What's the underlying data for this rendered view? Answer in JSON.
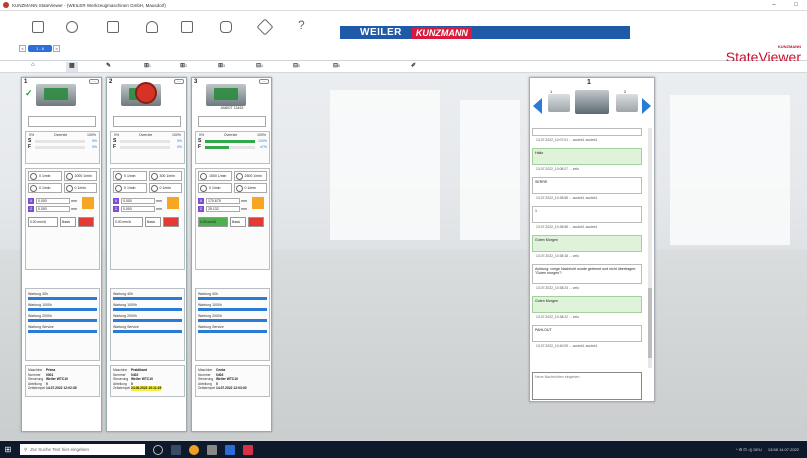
{
  "window": {
    "title": "KUNZMANN StateViewer - (WEILER Werkzeugmaschinen GmbH, Mausdorf)",
    "controls": [
      "–",
      "□"
    ]
  },
  "toolbar": {
    "nav_label": "1 - 6",
    "nav_prev": "<",
    "nav_next": ">"
  },
  "brand": {
    "weiler": "WEILER",
    "kunzmann": "KUNZMANN",
    "logo_small": "KUNZMANN",
    "logo_big": "StateViewer"
  },
  "colors": {
    "brand_blue": "#1f5aa8",
    "brand_red": "#d81b3c",
    "ok_green": "#2a9c3a",
    "alarm_red": "#d63327",
    "highlight": "#f4ee3c"
  },
  "tabs": [
    {
      "icon": "home-icon",
      "label": ""
    },
    {
      "icon": "grid-icon",
      "label": ""
    },
    {
      "icon": "wrench-icon",
      "label": ""
    },
    {
      "icon": "machine-icon",
      "label": "1"
    },
    {
      "icon": "machine-icon",
      "label": "2"
    },
    {
      "icon": "machine-icon",
      "label": "3"
    },
    {
      "icon": "machine-icon",
      "label": "4"
    },
    {
      "icon": "machine-icon",
      "label": "5"
    },
    {
      "icon": "machine-icon",
      "label": "6"
    },
    {
      "icon": "pen-icon",
      "label": ""
    }
  ],
  "panels": [
    {
      "num": "1",
      "program": "",
      "override_low": "0%",
      "override_label": "Override",
      "override_high": "100%",
      "s_pct": "0%",
      "f_pct": "0%",
      "s_level": 0.0,
      "f_level": 0.0,
      "spindles": [
        [
          "0",
          "1/min"
        ],
        [
          "2000",
          "1/min"
        ],
        [
          "0",
          "1/min"
        ],
        [
          "0",
          "1/min"
        ]
      ],
      "x_val": "0.000",
      "z_val": "0.000",
      "unit": "mm",
      "foot": [
        "0.00 mm/U",
        "Basis"
      ],
      "maint": [
        "Wartung 40h",
        "Wartung 1000h",
        "Wartung 2000h",
        "Wartung Service"
      ],
      "info": {
        "Maschine": "Prima",
        "Nummer": "0001",
        "Steuerung": "Weiler WTC10",
        "Abteilung": "0",
        "Zeitstempel": "14.07.2022 12:02:35"
      }
    },
    {
      "num": "2",
      "program": "",
      "override_low": "0%",
      "override_label": "Override",
      "override_high": "100%",
      "s_pct": "0%",
      "f_pct": "0%",
      "s_level": 0.0,
      "f_level": 0.0,
      "spindles": [
        [
          "0",
          "1/min"
        ],
        [
          "300",
          "1/min"
        ],
        [
          "0",
          "1/min"
        ],
        [
          "0",
          "1/min"
        ]
      ],
      "x_val": "0.000",
      "z_val": "0.000",
      "unit": "mm",
      "foot": [
        "0.00 mm/U",
        "Basis"
      ],
      "maint": [
        "Wartung 40h",
        "Wartung 1000h",
        "Wartung 2000h",
        "Wartung Service"
      ],
      "info": {
        "Maschine": "Praktikant",
        "Nummer": "0402",
        "Steuerung": "Weiler WTC10",
        "Abteilung": "0",
        "Zeitstempel": "24.06.2022 10:11:25"
      }
    },
    {
      "num": "3",
      "program": "ANBOT 13463",
      "override_low": "0%",
      "override_label": "Override",
      "override_high": "100%",
      "s_pct": "100%",
      "f_pct": "47%",
      "s_level": 1.0,
      "f_level": 0.47,
      "spindles": [
        [
          "1500",
          "1/min"
        ],
        [
          "2500",
          "1/min"
        ],
        [
          "0",
          "1/min"
        ],
        [
          "0",
          "1/min"
        ]
      ],
      "x_val": "170.675",
      "z_val": "25.132",
      "unit": "mm",
      "foot": [
        "0.05 mm/U",
        "Basis"
      ],
      "maint": [
        "Wartung 40h",
        "Wartung 1000h",
        "Wartung 2000h",
        "Wartung Service"
      ],
      "info": {
        "Maschine": "Centa",
        "Nummer": "0403",
        "Steuerung": "Weiler WTC10",
        "Abteilung": "0",
        "Zeitstempel": "14.07.2022 12:03:00"
      }
    }
  ],
  "chat": {
    "header_num": "1",
    "carousel_left": "1",
    "carousel_right": "2",
    "messages": [
      {
        "meta": "13.07.2022_10:07:01 ... acutek1 acutek1",
        "text": "",
        "green": false
      },
      {
        "meta": "13.07.2022_10:08:27 ... zelo",
        "text": "Hallo",
        "green": true
      },
      {
        "meta": "13.07.2022_10:38:58 ... acutek1 acutek1",
        "text": "SERRE",
        "green": false
      },
      {
        "meta": "13.07.2022_10:38:58 ... acutek1 acutek1",
        "text": "1",
        "green": false
      },
      {
        "meta": "13.07.2022_10:38:18 ... zelo",
        "text": "Guten Morgen",
        "green": true
      },
      {
        "meta": "13.07.2022_10:38:23 ... zelo",
        "text": "Achtung: vorige Nachricht wurde getrennt und nicht übertragen: \"Guten morgen\"!",
        "green": false
      },
      {
        "meta": "13.07.2022_10:38:22 ... zelo",
        "text": "Guten Morgen",
        "green": true
      },
      {
        "meta": "13.07.2022_10:40:09 ... acutek1 acutek1",
        "text": "PAHLOUT",
        "green": false
      }
    ],
    "input_placeholder": "Neue Nachrichten eingeben"
  },
  "taskbar": {
    "search_placeholder": "Zur Suche Text hier eingeben",
    "tray": "^  ⚙  ⊡  ◁)  DEU",
    "clock": "13:58 14.07.2022"
  }
}
